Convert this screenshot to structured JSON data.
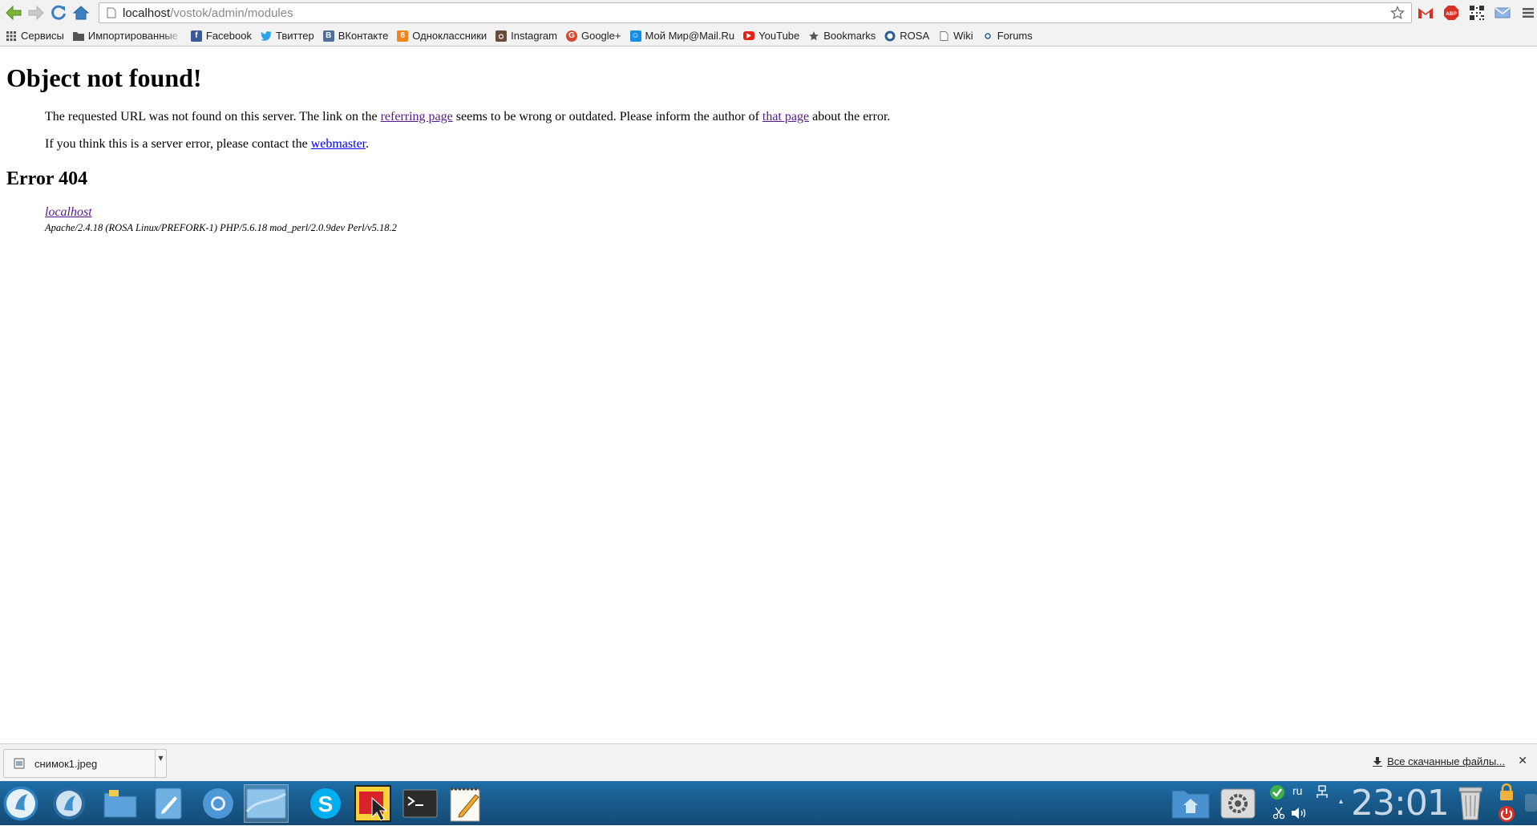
{
  "browser": {
    "url_host": "localhost",
    "url_path": "/vostok/admin/modules"
  },
  "bookmarks": [
    {
      "label": "Сервисы",
      "icon": "apps-grid-icon"
    },
    {
      "label": "Импортированные",
      "icon": "folder-icon"
    },
    {
      "label": "Facebook",
      "icon": "facebook-icon"
    },
    {
      "label": "Твиттер",
      "icon": "twitter-icon"
    },
    {
      "label": "ВКонтакте",
      "icon": "vk-icon"
    },
    {
      "label": "Одноклассники",
      "icon": "odnoklassniki-icon"
    },
    {
      "label": "Instagram",
      "icon": "instagram-icon"
    },
    {
      "label": "Google+",
      "icon": "google-plus-icon"
    },
    {
      "label": "Мой Мир@Mail.Ru",
      "icon": "mail-ru-icon"
    },
    {
      "label": "YouTube",
      "icon": "youtube-icon"
    },
    {
      "label": "Bookmarks",
      "icon": "star-icon"
    },
    {
      "label": "ROSA",
      "icon": "rosa-icon"
    },
    {
      "label": "Wiki",
      "icon": "page-icon"
    },
    {
      "label": "Forums",
      "icon": "forums-icon"
    }
  ],
  "page": {
    "title": "Object not found!",
    "p1_before": "The requested URL was not found on this server. The link on the ",
    "p1_link1": "referring page",
    "p1_middle": " seems to be wrong or outdated. Please inform the author of ",
    "p1_link2": "that page",
    "p1_after": " about the error.",
    "p2_before": "If you think this is a server error, please contact the ",
    "p2_link": "webmaster",
    "p2_after": ".",
    "error_heading": "Error 404",
    "address_host": "localhost",
    "address_signature": "Apache/2.4.18 (ROSA Linux/PREFORK-1) PHP/5.6.18 mod_perl/2.0.9dev Perl/v5.18.2"
  },
  "downloads": {
    "file_name": "снимок1.jpeg",
    "all_downloads_label": "Все скачанные файлы..."
  },
  "taskbar": {
    "clock": "23:01",
    "language": "ru"
  },
  "colors": {
    "visited_link": "#551a8b",
    "unvisited_link": "#0000ee",
    "taskbar": "#1a5d8f"
  }
}
